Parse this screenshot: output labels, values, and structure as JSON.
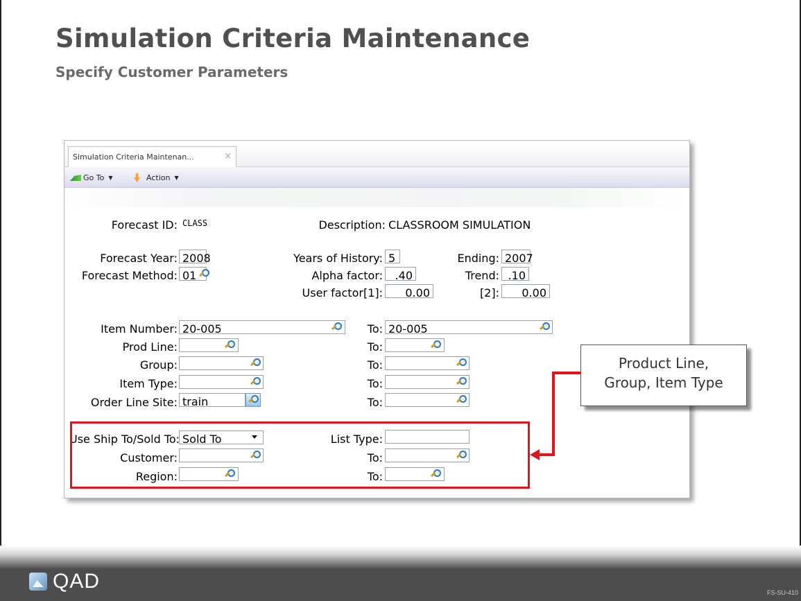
{
  "slide": {
    "title": "Simulation Criteria Maintenance",
    "subtitle": "Specify Customer Parameters",
    "logo_text": "QAD",
    "code": "FS-SU-410"
  },
  "window": {
    "tab_label": "Simulation Criteria Maintenan...",
    "tab_close": "×",
    "toolbar": {
      "goto_label": "Go To",
      "action_label": "Action"
    }
  },
  "form": {
    "forecast_id": {
      "label": "Forecast ID:",
      "value": "CLASS"
    },
    "description": {
      "label": "Description:",
      "value": "CLASSROOM SIMULATION"
    },
    "forecast_year": {
      "label": "Forecast Year:",
      "value": "2008"
    },
    "years_of_history": {
      "label": "Years of History:",
      "value": "5"
    },
    "ending": {
      "label": "Ending:",
      "value": "2007"
    },
    "forecast_method": {
      "label": "Forecast Method:",
      "value": "01"
    },
    "alpha_factor": {
      "label": "Alpha factor:",
      "value": ".40"
    },
    "trend": {
      "label": "Trend:",
      "value": ".10"
    },
    "user_factor_1": {
      "label": "User factor[1]:",
      "value": "0.00"
    },
    "user_factor_2": {
      "label": "[2]:",
      "value": "0.00"
    },
    "item_number": {
      "label": "Item Number:",
      "value": "20-005",
      "to_label": "To:",
      "to_value": "20-005"
    },
    "prod_line": {
      "label": "Prod Line:",
      "value": "",
      "to_label": "To:",
      "to_value": ""
    },
    "group": {
      "label": "Group:",
      "value": "",
      "to_label": "To:",
      "to_value": ""
    },
    "item_type": {
      "label": "Item Type:",
      "value": "",
      "to_label": "To:",
      "to_value": ""
    },
    "order_line_site": {
      "label": "Order Line Site:",
      "value": "train",
      "to_label": "To:",
      "to_value": ""
    },
    "use_ship_sold": {
      "label": "Use Ship To/Sold To:",
      "value": "Sold To"
    },
    "list_type": {
      "label": "List Type:",
      "value": ""
    },
    "customer": {
      "label": "Customer:",
      "value": "",
      "to_label": "To:",
      "to_value": ""
    },
    "region": {
      "label": "Region:",
      "value": "",
      "to_label": "To:",
      "to_value": ""
    }
  },
  "callout": {
    "line1": "Product Line,",
    "line2": "Group, Item Type"
  },
  "colors": {
    "highlight": "#e0141a",
    "footer": "#4d4d4d",
    "title": "#505050"
  },
  "icons": [
    "goto-icon",
    "action-icon",
    "lookup-icon",
    "close-icon",
    "qad-logo-icon"
  ]
}
